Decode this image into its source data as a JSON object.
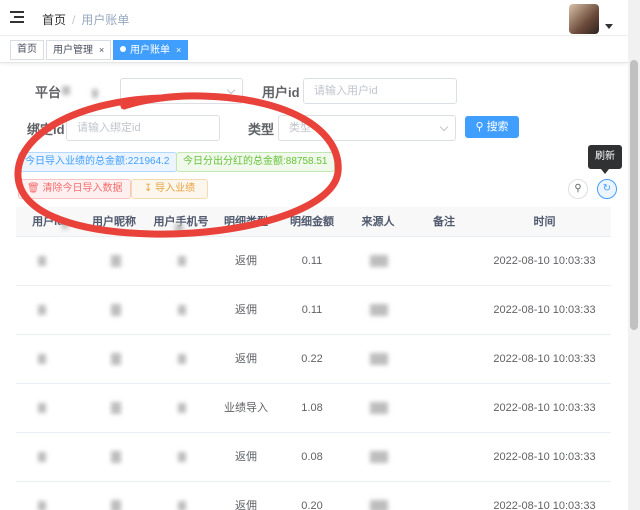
{
  "breadcrumb": {
    "home": "首页",
    "sep": "/",
    "current": "用户账单"
  },
  "tags": [
    {
      "label": "首页",
      "closable": false,
      "active": false
    },
    {
      "label": "用户管理",
      "closable": true,
      "active": false
    },
    {
      "label": "用户账单",
      "closable": true,
      "active": true
    }
  ],
  "filters": {
    "platform_label": "平台",
    "user_id_label": "用户id",
    "user_id_placeholder": "请输入用户id",
    "bind_id_label": "绑定id",
    "bind_id_placeholder": "请输入绑定id",
    "type_label": "类型",
    "type_placeholder": "类型",
    "search_button": "搜索"
  },
  "stats": {
    "import_total": "今日导入业绩的总金额:221964.2",
    "dividend_total": "今日分出分红的总金额:88758.51"
  },
  "actions": {
    "clear": "清除今日导入数据",
    "import": "导入业绩"
  },
  "toolbar": {
    "refresh_tooltip": "刷新"
  },
  "table": {
    "columns": [
      "用户id",
      "用户昵称",
      "用户手机号",
      "明细类型",
      "明细金额",
      "来源人",
      "备注",
      "时间"
    ],
    "rows": [
      {
        "type": "返佣",
        "amount": "0.11",
        "time": "2022-08-10 10:03:33"
      },
      {
        "type": "返佣",
        "amount": "0.11",
        "time": "2022-08-10 10:03:33"
      },
      {
        "type": "返佣",
        "amount": "0.22",
        "time": "2022-08-10 10:03:33"
      },
      {
        "type": "业绩导入",
        "amount": "1.08",
        "time": "2022-08-10 10:03:33"
      },
      {
        "type": "返佣",
        "amount": "0.08",
        "time": "2022-08-10 10:03:33"
      },
      {
        "type": "返佣",
        "amount": "0.20",
        "time": "2022-08-10 10:03:33"
      }
    ]
  },
  "colors": {
    "primary": "#409eff",
    "success": "#67c23a",
    "danger": "#f56c6c",
    "warning": "#e6a23c",
    "annotation": "#e8423b"
  }
}
